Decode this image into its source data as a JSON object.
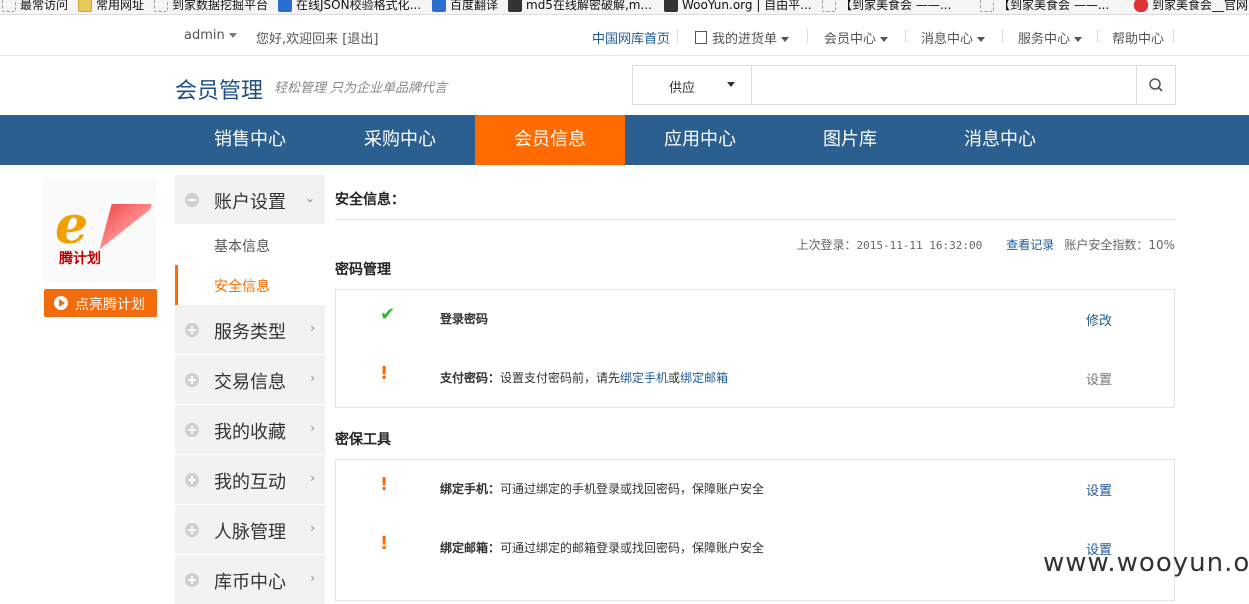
{
  "bookmarks": [
    {
      "label": "最常访问",
      "icon": "bookmark-icon"
    },
    {
      "label": "常用网址",
      "icon": "folder-icon"
    },
    {
      "label": "到家数据挖掘平台",
      "icon": "page-icon"
    },
    {
      "label": "在线JSON校验格式化...",
      "icon": "json-icon"
    },
    {
      "label": "百度翻译",
      "icon": "baidu-translate-icon"
    },
    {
      "label": "md5在线解密破解,m...",
      "icon": "grid-icon"
    },
    {
      "label": "WooYun.org | 自由平...",
      "icon": "wooyun-icon"
    },
    {
      "label": "【到家美食会 ——...",
      "icon": "page-icon"
    },
    {
      "label": "【到家美食会 ——...",
      "icon": "page-icon"
    },
    {
      "label": "到家美食会__官网",
      "icon": "daojia-icon"
    }
  ],
  "util": {
    "user": "admin",
    "greeting": "您好,欢迎回来",
    "logout": "[退出]",
    "links": [
      "中国网库首页",
      "我的进货单",
      "会员中心",
      "消息中心",
      "服务中心",
      "帮助中心"
    ]
  },
  "header": {
    "title": "会员管理",
    "slogan": "轻松管理 只为企业单品牌代言",
    "search_type": "供应",
    "search_placeholder": ""
  },
  "nav": [
    "销售中心",
    "采购中心",
    "会员信息",
    "应用中心",
    "图片库",
    "消息中心"
  ],
  "badge": {
    "logo_text": "腾计划",
    "button": "点亮腾计划"
  },
  "sidebar": {
    "groups": [
      {
        "label": "账户设置",
        "expanded": true,
        "subs": [
          "基本信息",
          "安全信息"
        ]
      },
      {
        "label": "服务类型"
      },
      {
        "label": "交易信息"
      },
      {
        "label": "我的收藏"
      },
      {
        "label": "我的互动"
      },
      {
        "label": "人脉管理"
      },
      {
        "label": "库币中心"
      }
    ]
  },
  "main": {
    "title": "安全信息：",
    "last_login_label": "上次登录：",
    "last_login_time": "2015-11-11 16:32:00",
    "view_records": "查看记录",
    "security_index": "账户安全指数：10%",
    "password_section": "密码管理",
    "password_rows": [
      {
        "status": "ok",
        "title": "登录密码",
        "text": "",
        "link1": "",
        "mid": "",
        "link2": "",
        "action": "修改"
      },
      {
        "status": "warn",
        "title": "支付密码：",
        "text": "设置支付密码前，请先",
        "link1": "绑定手机",
        "mid": "或",
        "link2": "绑定邮箱",
        "action": "设置"
      }
    ],
    "tools_section": "密保工具",
    "tools_rows": [
      {
        "status": "warn",
        "title": "绑定手机：",
        "text": "可通过绑定的手机登录或找回密码，保障账户安全",
        "action": "设置"
      },
      {
        "status": "warn",
        "title": "绑定邮箱：",
        "text": "可通过绑定的邮箱登录或找回密码，保障账户安全",
        "action": "设置"
      }
    ]
  },
  "watermark": "www.wooyun.org",
  "colors": {
    "nav_bg": "#2b5f8f",
    "accent": "#ff6b00",
    "link": "#1d5b9a",
    "ok": "#2eb82e"
  }
}
